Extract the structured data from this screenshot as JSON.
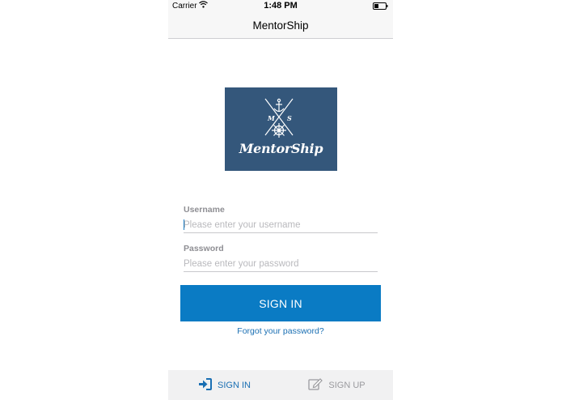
{
  "status_bar": {
    "carrier": "Carrier",
    "time": "1:48 PM"
  },
  "nav": {
    "title": "MentorShip"
  },
  "logo": {
    "text": "MentorShip",
    "letters": [
      "M",
      "S"
    ],
    "background": "#34577b"
  },
  "form": {
    "username_label": "Username",
    "username_placeholder": "Please enter your username",
    "password_label": "Password",
    "password_placeholder": "Please enter your password",
    "signin_label": "SIGN IN",
    "forgot_label": "Forgot your password?"
  },
  "tabbar": {
    "items": [
      {
        "label": "SIGN IN",
        "icon": "sign-in-icon",
        "active": true
      },
      {
        "label": "SIGN UP",
        "icon": "edit-icon",
        "active": false
      }
    ]
  },
  "colors": {
    "accent": "#0a7bc4",
    "link": "#1a6fb3",
    "inactive": "#9a9a9e"
  }
}
